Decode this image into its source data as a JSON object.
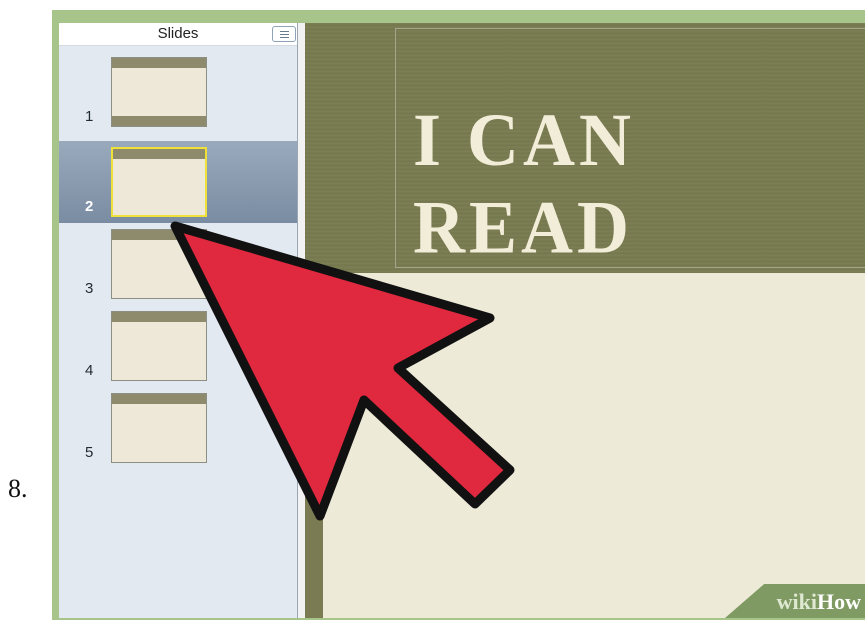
{
  "step": {
    "number": "8."
  },
  "sidebar": {
    "header": "Slides",
    "selected_index": 2,
    "slides": [
      {
        "number": "1"
      },
      {
        "number": "2"
      },
      {
        "number": "3"
      },
      {
        "number": "4"
      },
      {
        "number": "5"
      }
    ]
  },
  "slide_canvas": {
    "title_text": "I CAN READ"
  },
  "watermark": {
    "prefix": "wiki",
    "suffix": "How"
  },
  "colors": {
    "frame": "#a7c48b",
    "selection": "#7a8ca2",
    "thumb_highlight": "#f0e03a",
    "arrow": "#e0283e"
  },
  "icons": {
    "sidebar_toggle": "list-icon"
  }
}
